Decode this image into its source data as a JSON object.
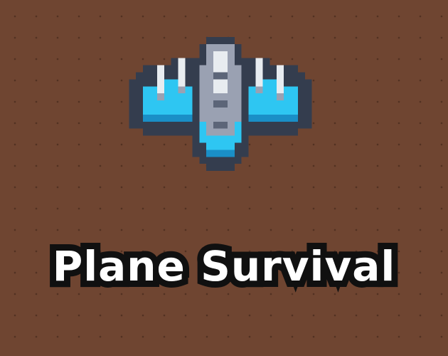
{
  "game": {
    "title": "Plane Survival",
    "background_color": "#6f4531",
    "sprite": "pixel-art-fighter-plane",
    "colors": {
      "outline": "#343d4e",
      "wing": "#2ec6f2",
      "wing_dark": "#1a8fc7",
      "fuselage": "#9aa1b2",
      "highlight": "#e8ecf0",
      "title_fill": "#ffffff",
      "title_stroke": "#101010"
    }
  }
}
